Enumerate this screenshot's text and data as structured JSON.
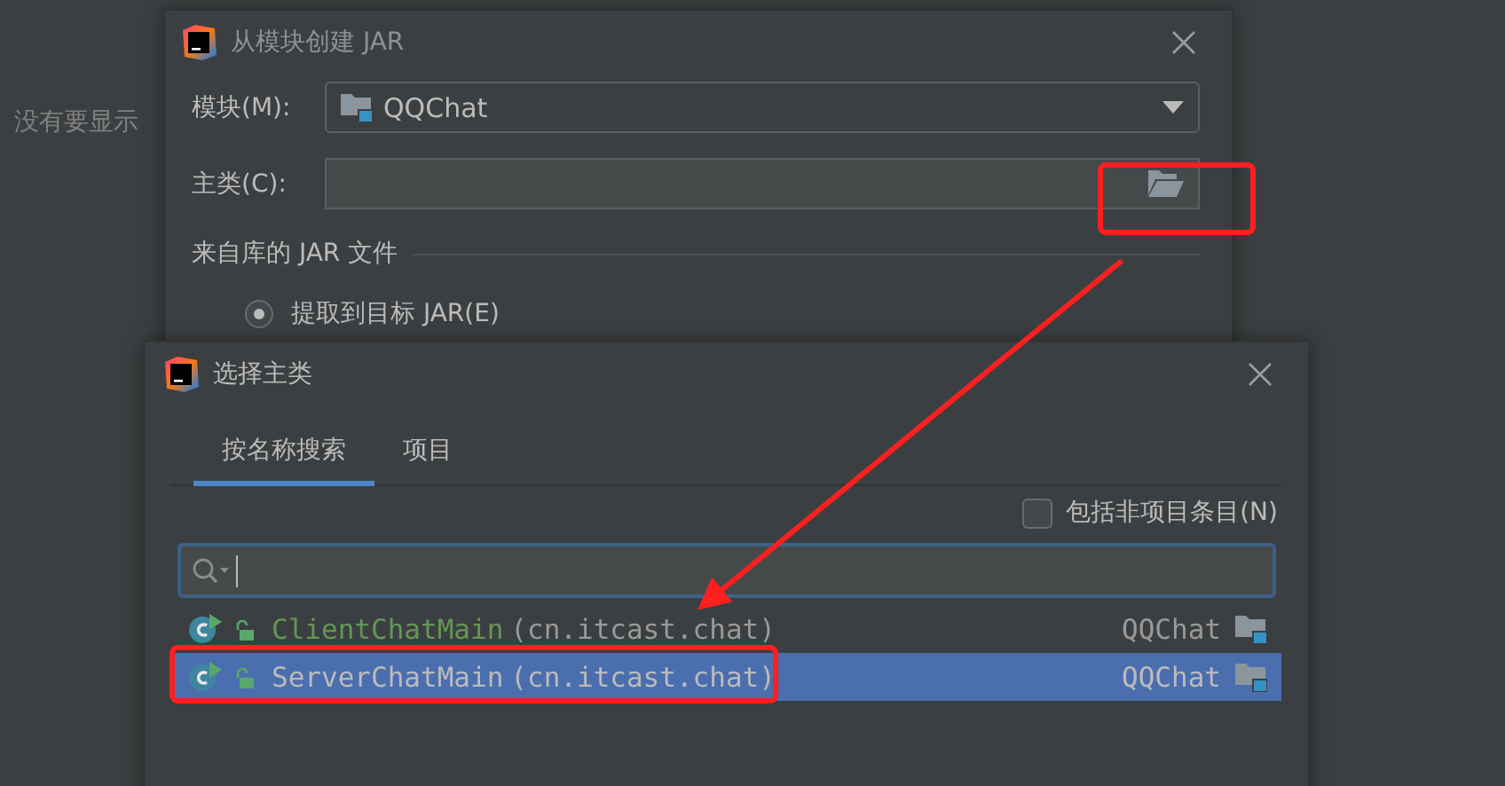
{
  "background_text": "没有要显示",
  "jar_dialog": {
    "title": "从模块创建 JAR",
    "module": {
      "label": "模块(M):",
      "value": "QQChat"
    },
    "main_class": {
      "label": "主类(C):"
    },
    "section": "来自库的 JAR 文件",
    "extract_option": {
      "label": "提取到目标 JAR(E)",
      "selected": true
    }
  },
  "chooser_dialog": {
    "title": "选择主类",
    "tabs": [
      {
        "label": "按名称搜索",
        "selected": true
      },
      {
        "label": "项目",
        "selected": false
      }
    ],
    "include_non_project": {
      "label": "包括非项目条目(N)",
      "checked": false
    },
    "rows": [
      {
        "name": "ClientChatMain",
        "package": "(cn.itcast.chat)",
        "module": "QQChat",
        "selected": false,
        "color": "#629755"
      },
      {
        "name": "ServerChatMain",
        "package": "(cn.itcast.chat)",
        "module": "QQChat",
        "selected": true
      }
    ]
  }
}
